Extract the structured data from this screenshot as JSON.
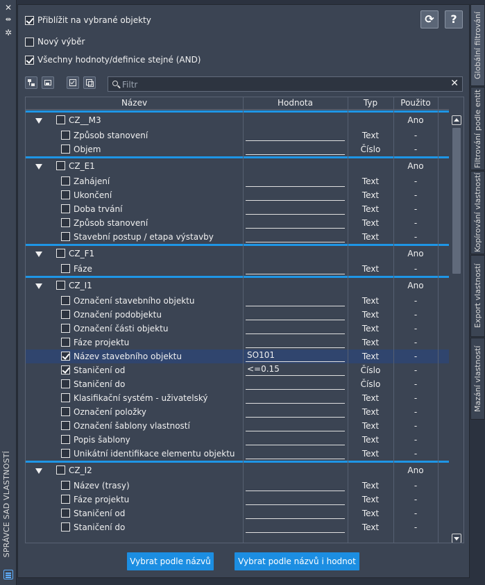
{
  "palette_title": "SPRÁVCE SAD VLASTNOSTÍ",
  "options": {
    "zoom_label": "Přiblížit na vybrané objekty",
    "zoom_checked": true,
    "new_selection_label": "Nový výběr",
    "new_selection_checked": false,
    "all_values_label": "Všechny hodnoty/definice stejné (AND)",
    "all_values_checked": true
  },
  "top_buttons": {
    "refresh_icon": "refresh-icon",
    "help_label": "?"
  },
  "filter": {
    "placeholder": "Filtr"
  },
  "columns": {
    "name": "Název",
    "value": "Hodnota",
    "type": "Typ",
    "used": "Použito"
  },
  "groups": [
    {
      "name": "CZ__M3",
      "used": "Ano",
      "rows": [
        {
          "name": "Způsob stanovení",
          "value": "",
          "type": "Text",
          "used": "-",
          "checked": false
        },
        {
          "name": "Objem",
          "value": "",
          "type": "Číslo",
          "used": "-",
          "checked": false
        }
      ]
    },
    {
      "name": "CZ_E1",
      "used": "Ano",
      "rows": [
        {
          "name": "Zahájení",
          "value": "",
          "type": "Text",
          "used": "-",
          "checked": false
        },
        {
          "name": "Ukončení",
          "value": "",
          "type": "Text",
          "used": "-",
          "checked": false
        },
        {
          "name": "Doba trvání",
          "value": "",
          "type": "Text",
          "used": "-",
          "checked": false
        },
        {
          "name": "Způsob stanovení",
          "value": "",
          "type": "Text",
          "used": "-",
          "checked": false
        },
        {
          "name": "Stavební postup / etapa výstavby",
          "value": "",
          "type": "Text",
          "used": "-",
          "checked": false
        }
      ]
    },
    {
      "name": "CZ_F1",
      "used": "Ano",
      "rows": [
        {
          "name": "Fáze",
          "value": "",
          "type": "Text",
          "used": "-",
          "checked": false
        }
      ]
    },
    {
      "name": "CZ_I1",
      "used": "Ano",
      "rows": [
        {
          "name": "Označení stavebního objektu",
          "value": "",
          "type": "Text",
          "used": "-",
          "checked": false
        },
        {
          "name": "Označení podobjektu",
          "value": "",
          "type": "Text",
          "used": "-",
          "checked": false
        },
        {
          "name": "Označení části objektu",
          "value": "",
          "type": "Text",
          "used": "-",
          "checked": false
        },
        {
          "name": "Fáze projektu",
          "value": "",
          "type": "Text",
          "used": "-",
          "checked": false
        },
        {
          "name": "Název stavebního objektu",
          "value": "SO101",
          "type": "Text",
          "used": "-",
          "checked": true,
          "selected": true
        },
        {
          "name": "Staničení od",
          "value": "<=0.15",
          "type": "Číslo",
          "used": "-",
          "checked": true
        },
        {
          "name": "Staničení do",
          "value": "",
          "type": "Číslo",
          "used": "-",
          "checked": false
        },
        {
          "name": "Klasifikační systém - uživatelský",
          "value": "",
          "type": "Text",
          "used": "-",
          "checked": false
        },
        {
          "name": "Označení položky",
          "value": "",
          "type": "Text",
          "used": "-",
          "checked": false
        },
        {
          "name": "Označení šablony vlastností",
          "value": "",
          "type": "Text",
          "used": "-",
          "checked": false
        },
        {
          "name": "Popis šablony",
          "value": "",
          "type": "Text",
          "used": "-",
          "checked": false
        },
        {
          "name": "Unikátní identifikace elementu objektu",
          "value": "",
          "type": "Text",
          "used": "-",
          "checked": false
        }
      ]
    },
    {
      "name": "CZ_I2",
      "used": "Ano",
      "rows": [
        {
          "name": "Název (trasy)",
          "value": "",
          "type": "Text",
          "used": "-",
          "checked": false
        },
        {
          "name": "Fáze projektu",
          "value": "",
          "type": "Text",
          "used": "-",
          "checked": false
        },
        {
          "name": "Staničení od",
          "value": "",
          "type": "Text",
          "used": "-",
          "checked": false
        },
        {
          "name": "Staničení do",
          "value": "",
          "type": "Text",
          "used": "-",
          "checked": false
        }
      ]
    }
  ],
  "buttons": {
    "select_by_name": "Vybrat podle názvů",
    "select_by_name_value": "Vybrat podle názvů i hodnot"
  },
  "right_tabs": [
    "Globální filtrování",
    "Filtrování podle entit",
    "Kopírování vlastností",
    "Export vlastností",
    "Mazání vlastností"
  ]
}
